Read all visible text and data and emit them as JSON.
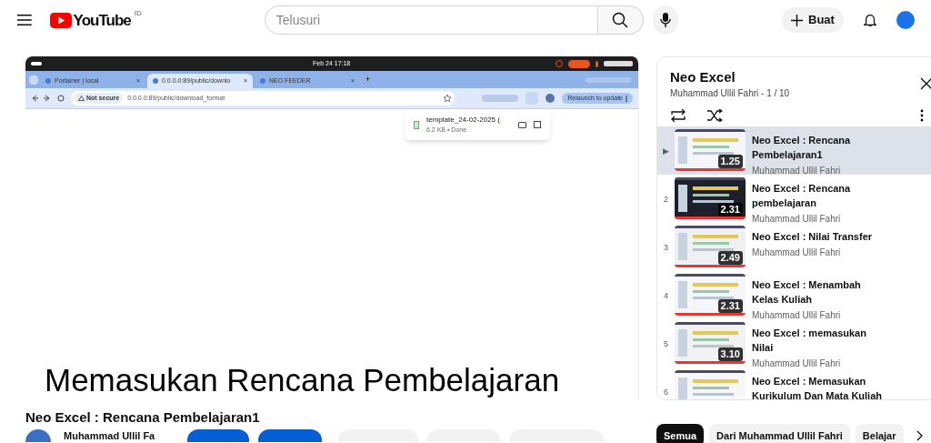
{
  "header": {
    "logo_text": "YouTube",
    "country": "ID",
    "search_placeholder": "Telusuri",
    "create_label": "Buat"
  },
  "video": {
    "os_bar": {
      "clock": "Feb 24  17:18"
    },
    "browser_tabs": [
      {
        "label": "Portainer | local",
        "selected": false,
        "close": "×"
      },
      {
        "label": "0.0.0.0:89/public/downlo",
        "selected": true,
        "close": "×"
      },
      {
        "label": "NEO FEEDER",
        "selected": false,
        "close": "×"
      }
    ],
    "new_tab": "+",
    "security": "Not secure",
    "url": "0.0.0.0:89/public/download_format",
    "relaunch": "Relaunch to update",
    "download": {
      "filename": "template_24-02-2025 (",
      "detail": "6.2 KB • Done"
    },
    "caption": "Memasukan Rencana Pembelajaran"
  },
  "video_title": "Neo Excel : Rencana Pembelajaran1",
  "channel": {
    "name": "Muhammad Ullil Fa"
  },
  "playlist": {
    "title": "Neo Excel",
    "subtitle": "Muhammad Ullil Fahri - 1 / 10",
    "items": [
      {
        "index": "▶",
        "title": "Neo Excel : Rencana Pembelajaran1",
        "channel": "Muhammad Ullil Fahri",
        "duration": "1.25",
        "selected": true
      },
      {
        "index": "2",
        "title": "Neo Excel : Rencana pembelajaran",
        "channel": "Muhammad Ullil Fahri",
        "duration": "2.31",
        "selected": false
      },
      {
        "index": "3",
        "title": "Neo Excel : Nilai Transfer",
        "channel": "Muhammad Ullil Fahri",
        "duration": "2.49",
        "selected": false
      },
      {
        "index": "4",
        "title": "Neo Excel : Menambah Kelas Kuliah",
        "channel": "Muhammad Ullil Fahri",
        "duration": "2.31",
        "selected": false
      },
      {
        "index": "5",
        "title": "Neo Excel : memasukan Nilai",
        "channel": "Muhammad Ullil Fahri",
        "duration": "3.10",
        "selected": false
      },
      {
        "index": "6",
        "title": "Neo Excel : Memasukan Kurikulum Dan Mata Kuliah",
        "selected": false
      }
    ]
  },
  "chips": [
    {
      "label": "Semua",
      "selected": true
    },
    {
      "label": "Dari Muhammad Ullil Fahri",
      "selected": false
    },
    {
      "label": "Belajar",
      "selected": false
    }
  ]
}
